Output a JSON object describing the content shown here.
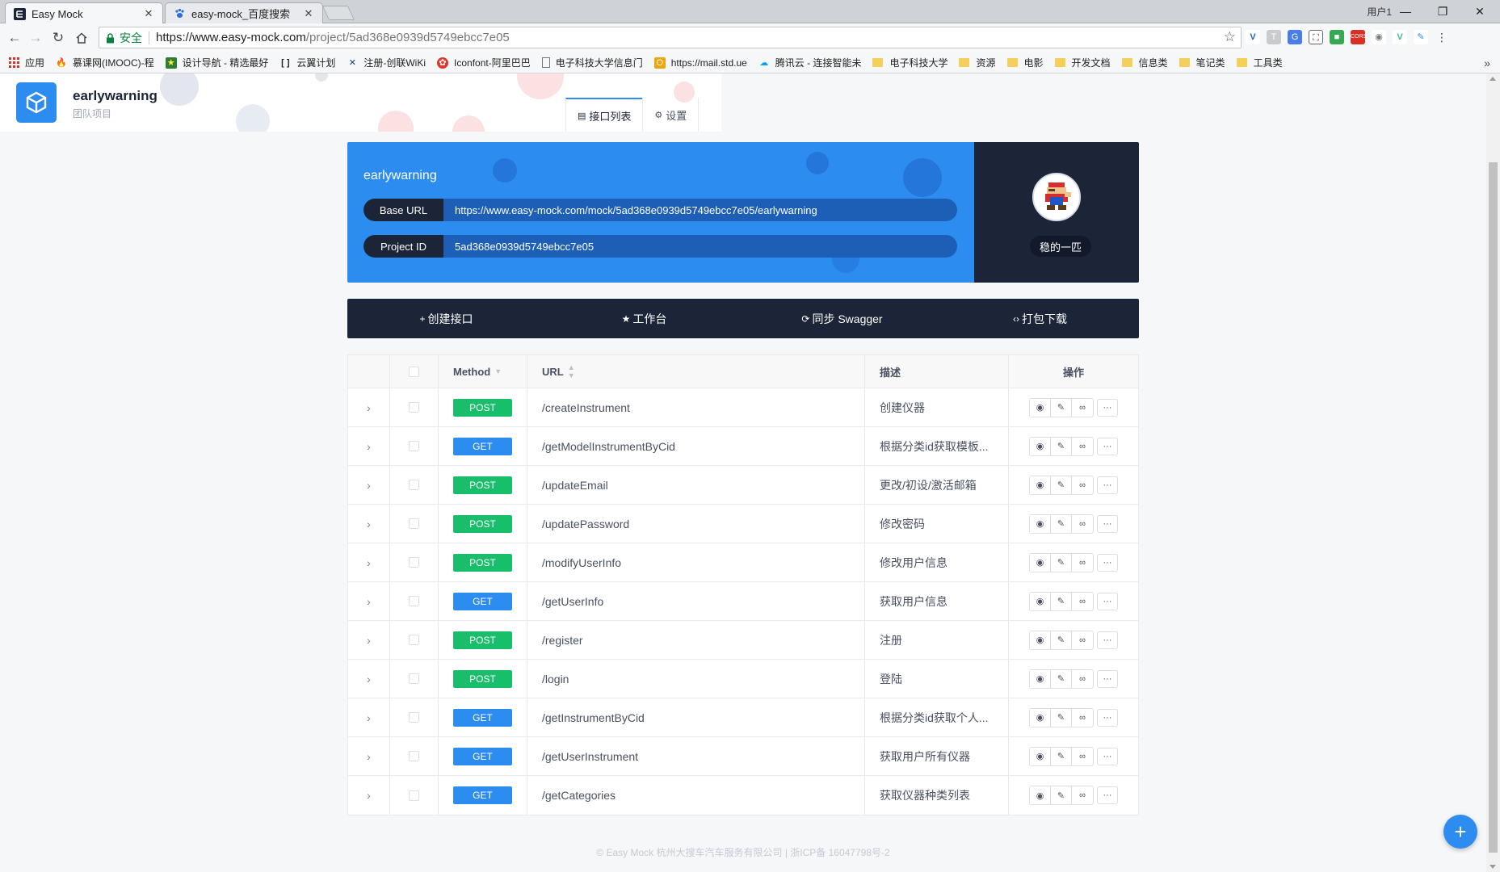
{
  "browser": {
    "tabs": [
      {
        "title": "Easy Mock",
        "favicon": "easy-mock-logo-icon",
        "active": true
      },
      {
        "title": "easy-mock_百度搜索",
        "favicon": "baidu-paw-icon",
        "active": false
      }
    ],
    "window_user": "用户1",
    "address": {
      "secure_label": "安全",
      "host": "https://www.easy-mock.com",
      "path": "/project/5ad368e0939d5749ebcc7e05"
    },
    "bookmarks": [
      {
        "label": "应用",
        "icon": "apps-grid-icon"
      },
      {
        "label": "慕课网(IMOOC)-程",
        "icon": "flame-icon"
      },
      {
        "label": "设计导航 - 精选最好",
        "icon": "shield-badge-icon"
      },
      {
        "label": "云翼计划",
        "icon": "cloud-bracket-icon"
      },
      {
        "label": "注册-创联WiKi",
        "icon": "x-logo-icon"
      },
      {
        "label": "Iconfont-阿里巴巴",
        "icon": "iconfont-logo-icon"
      },
      {
        "label": "电子科技大学信息门",
        "icon": "page-icon"
      },
      {
        "label": "https://mail.std.ue",
        "icon": "mail-logo-icon"
      },
      {
        "label": "腾讯云 - 连接智能未",
        "icon": "tencent-cloud-icon"
      },
      {
        "label": "电子科技大学",
        "icon": "folder-icon"
      },
      {
        "label": "资源",
        "icon": "folder-icon"
      },
      {
        "label": "电影",
        "icon": "folder-icon"
      },
      {
        "label": "开发文档",
        "icon": "folder-icon"
      },
      {
        "label": "信息类",
        "icon": "folder-icon"
      },
      {
        "label": "笔记类",
        "icon": "folder-icon"
      },
      {
        "label": "工具类",
        "icon": "folder-icon"
      }
    ],
    "bookmarks_more": "»"
  },
  "header": {
    "project_name": "earlywarning",
    "project_type": "团队项目",
    "tabs": [
      {
        "label": "接口列表",
        "icon": "list-icon"
      },
      {
        "label": "设置",
        "icon": "gear-icon"
      }
    ]
  },
  "project_info": {
    "title": "earlywarning",
    "base_url_label": "Base URL",
    "base_url": "https://www.easy-mock.com/mock/5ad368e0939d5749ebcc7e05/earlywarning",
    "project_id_label": "Project ID",
    "project_id": "5ad368e0939d5749ebcc7e05",
    "username": "稳的一匹"
  },
  "actions": [
    {
      "label": "创建接口",
      "icon": "plus-icon"
    },
    {
      "label": "工作台",
      "icon": "star-icon"
    },
    {
      "label": "同步 Swagger",
      "icon": "sync-icon"
    },
    {
      "label": "打包下载",
      "icon": "code-icon"
    }
  ],
  "table": {
    "headers": {
      "method": "Method",
      "url": "URL",
      "desc": "描述",
      "ops": "操作"
    },
    "rows": [
      {
        "method": "POST",
        "url": "/createInstrument",
        "desc": "创建仪器"
      },
      {
        "method": "GET",
        "url": "/getModelInstrumentByCid",
        "desc": "根据分类id获取模板..."
      },
      {
        "method": "POST",
        "url": "/updateEmail",
        "desc": "更改/初设/激活邮箱"
      },
      {
        "method": "POST",
        "url": "/updatePassword",
        "desc": "修改密码"
      },
      {
        "method": "POST",
        "url": "/modifyUserInfo",
        "desc": "修改用户信息"
      },
      {
        "method": "GET",
        "url": "/getUserInfo",
        "desc": "获取用户信息"
      },
      {
        "method": "POST",
        "url": "/register",
        "desc": "注册"
      },
      {
        "method": "POST",
        "url": "/login",
        "desc": "登陆"
      },
      {
        "method": "GET",
        "url": "/getInstrumentByCid",
        "desc": "根据分类id获取个人..."
      },
      {
        "method": "GET",
        "url": "/getUserInstrument",
        "desc": "获取用户所有仪器"
      },
      {
        "method": "GET",
        "url": "/getCategories",
        "desc": "获取仪器种类列表"
      }
    ],
    "op_icons": [
      "eye-icon",
      "pencil-icon",
      "link-icon",
      "more-icon"
    ]
  },
  "footer": "© Easy Mock 杭州大搜车汽车服务有限公司 | 浙ICP备 16047798号-2",
  "colors": {
    "primary": "#2d8cf0",
    "dark": "#1c2438",
    "post": "#19be6b",
    "get": "#2d8cf0"
  }
}
